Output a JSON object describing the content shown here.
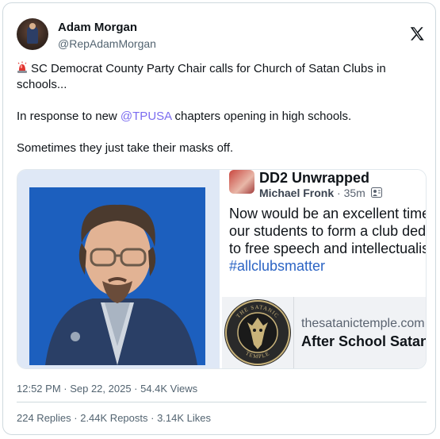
{
  "author": {
    "name": "Adam Morgan",
    "handle": "@RepAdamMorgan"
  },
  "tweet": {
    "line1": "SC Democrat County Party Chair calls for Church of Satan Clubs in schools...",
    "line2_before": "In response to new ",
    "line2_mention": "@TPUSA",
    "line2_after": " chapters opening in high schools.",
    "line3": "Sometimes they just take their masks off.",
    "emoji_icon": "rotating-siren-icon"
  },
  "embedded_post": {
    "page_name": "DD2 Unwrapped",
    "poster": "Michael Fronk",
    "time": "35m",
    "body_lines": [
      "Now would be an excellent time",
      "our students to form a club ded",
      "to free speech and intellectualis"
    ],
    "hashtag": "#allclubsmatter",
    "link_domain": "thesatanictemple.com",
    "link_title": "After School Satan",
    "seal_text": "THE SATANIC TEMPLE"
  },
  "meta": {
    "timestamp": "12:52 PM · Sep 22, 2025 · 54.4K Views"
  },
  "stats": {
    "replies": "224 Replies",
    "reposts": "2.44K Reposts",
    "likes": "3.14K Likes",
    "sep": " · "
  },
  "colors": {
    "mention": "#7b6cf0",
    "hashtag": "#2b64c4",
    "photo_bg": "#1c5fbe",
    "panel_bg": "#dfe8f6"
  }
}
